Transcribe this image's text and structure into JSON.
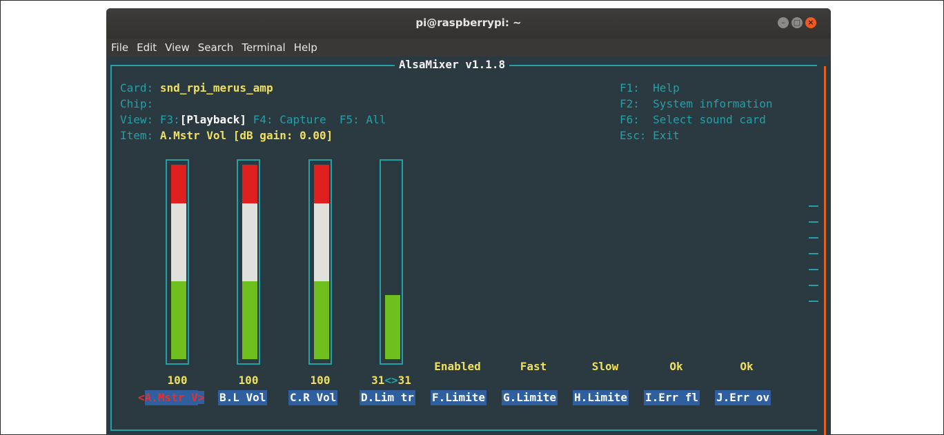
{
  "window": {
    "title": "pi@raspberrypi: ~",
    "buttons": {
      "minimize": "–",
      "maximize": "□",
      "close": "×"
    }
  },
  "menubar": [
    "File",
    "Edit",
    "View",
    "Search",
    "Terminal",
    "Help"
  ],
  "mixer": {
    "frame_title": "AlsaMixer v1.1.8",
    "card_label": "Card:",
    "card_value": "snd_rpi_merus_amp",
    "chip_label": "Chip:",
    "view_label": "View:",
    "view_f3_key": "F3:",
    "view_f3_value": "[Playback]",
    "view_f4": "F4: Capture",
    "view_f5": "F5: All",
    "item_label": "Item:",
    "item_value": "A.Mstr Vol [dB gain: 0.00]",
    "help": [
      {
        "key": "F1:",
        "label": "Help"
      },
      {
        "key": "F2:",
        "label": "System information"
      },
      {
        "key": "F6:",
        "label": "Select sound card"
      },
      {
        "key": "Esc:",
        "label": "Exit"
      }
    ],
    "channels": [
      {
        "level_label": "100",
        "level": 1.0,
        "name": "A.Mstr V",
        "selected": true
      },
      {
        "level_label": "100",
        "level": 1.0,
        "name": "B.L Vol",
        "selected": false
      },
      {
        "level_label": "100",
        "level": 1.0,
        "name": "C.R Vol",
        "selected": false
      },
      {
        "level_label": "31",
        "level_right": "31",
        "level": 0.33,
        "name": "D.Lim tr",
        "selected": false
      }
    ],
    "level_sep": "<>",
    "switches": [
      {
        "status": "Enabled",
        "name": "F.Limite"
      },
      {
        "status": "Fast",
        "name": "G.Limite"
      },
      {
        "status": "Slow",
        "name": "H.Limite"
      },
      {
        "status": "Ok",
        "name": "I.Err fl"
      },
      {
        "status": "Ok",
        "name": "J.Err ov"
      }
    ],
    "select_left": "<",
    "select_right": ">"
  },
  "colors": {
    "terminal_bg": "#2b3a40",
    "frame": "#23a0a8",
    "highlight_text": "#f0e060",
    "control_bg": "#2f5f9e",
    "selected_text": "#e03030",
    "bar_red": "#e02020",
    "bar_white": "#e0e0dc",
    "bar_green": "#6fc01e"
  }
}
